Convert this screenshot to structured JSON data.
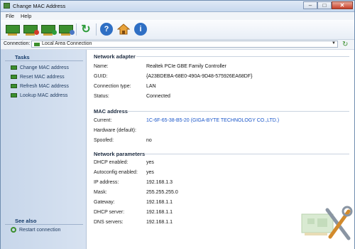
{
  "window": {
    "title": "Change MAC Address"
  },
  "menu": {
    "items": [
      "File",
      "Help"
    ]
  },
  "toolbar": {
    "buttons": [
      {
        "name": "change-mac",
        "icon": "network-card-icon"
      },
      {
        "name": "reset-mac",
        "icon": "network-card-reset-icon"
      },
      {
        "name": "refresh-mac",
        "icon": "network-card-refresh-icon"
      },
      {
        "name": "lookup-mac",
        "icon": "network-card-lookup-icon"
      },
      {
        "name": "refresh",
        "icon": "refresh-icon"
      },
      {
        "name": "help",
        "icon": "help-icon"
      },
      {
        "name": "home",
        "icon": "home-icon"
      },
      {
        "name": "info",
        "icon": "info-icon"
      }
    ]
  },
  "connection": {
    "label": "Connection:",
    "value": "Local Area Connection"
  },
  "sidebar": {
    "tasks_header": "Tasks",
    "tasks": [
      "Change MAC address",
      "Reset MAC address",
      "Refresh MAC address",
      "Lookup MAC address"
    ],
    "see_also_header": "See also",
    "see_also": [
      "Restart connection"
    ]
  },
  "sections": {
    "adapter": {
      "title": "Network adapter",
      "rows": [
        {
          "label": "Name:",
          "value": "Realtek PCIe GBE Family Controller"
        },
        {
          "label": "GUID:",
          "value": "{A23BDEBA-68E0-490A-9D48-575926EA68DF}"
        },
        {
          "label": "Connection type:",
          "value": "LAN"
        },
        {
          "label": "Status:",
          "value": "Connected"
        }
      ]
    },
    "mac": {
      "title": "MAC address",
      "rows": [
        {
          "label": "Current:",
          "value": "1C-6F-65-38-B5-20 (GIGA-BYTE TECHNOLOGY CO.,LTD.)"
        },
        {
          "label": "Hardware (default):",
          "value": ""
        },
        {
          "label": "Spoofed:",
          "value": "no"
        }
      ]
    },
    "params": {
      "title": "Network parameters",
      "rows": [
        {
          "label": "DHCP enabled:",
          "value": "yes"
        },
        {
          "label": "Autoconfig enabled:",
          "value": "yes"
        },
        {
          "label": "IP address:",
          "value": "192.168.1.3"
        },
        {
          "label": "Mask:",
          "value": "255.255.255.0"
        },
        {
          "label": "Gateway:",
          "value": "192.168.1.1"
        },
        {
          "label": "DHCP server:",
          "value": "192.168.1.1"
        },
        {
          "label": "DNS servers:",
          "value": "192.168.1.1"
        }
      ]
    }
  },
  "colors": {
    "link": "#1a56c9",
    "nic_green": "#3c8f2e",
    "sidebar": "#d0ddef"
  }
}
